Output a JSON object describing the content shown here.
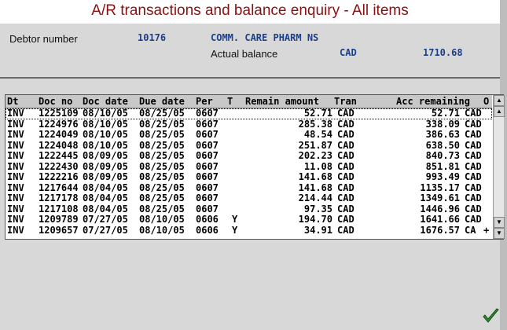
{
  "title": "A/R transactions and balance enquiry - All items",
  "header": {
    "debtor_label": "Debtor number",
    "debtor_number": "10176",
    "debtor_name": "COMM. CARE PHARM NS",
    "balance_label": "Actual balance",
    "balance_currency": "CAD",
    "balance_amount": "1710.68"
  },
  "columns": [
    "Dt",
    "Doc no",
    "Doc date",
    "Due date",
    "Per",
    "T",
    "Remain amount",
    "Tran",
    "Acc remaining",
    "O"
  ],
  "rows": [
    {
      "dt": "INV",
      "doc": "1225109",
      "docdate": "08/10/05",
      "duedate": "08/25/05",
      "per": "0607",
      "t": "",
      "remain": "52.71",
      "tran": "CAD",
      "acc": "52.71",
      "cur": "CAD",
      "o": ""
    },
    {
      "dt": "INV",
      "doc": "1224976",
      "docdate": "08/10/05",
      "duedate": "08/25/05",
      "per": "0607",
      "t": "",
      "remain": "285.38",
      "tran": "CAD",
      "acc": "338.09",
      "cur": "CAD",
      "o": ""
    },
    {
      "dt": "INV",
      "doc": "1224049",
      "docdate": "08/10/05",
      "duedate": "08/25/05",
      "per": "0607",
      "t": "",
      "remain": "48.54",
      "tran": "CAD",
      "acc": "386.63",
      "cur": "CAD",
      "o": ""
    },
    {
      "dt": "INV",
      "doc": "1224048",
      "docdate": "08/10/05",
      "duedate": "08/25/05",
      "per": "0607",
      "t": "",
      "remain": "251.87",
      "tran": "CAD",
      "acc": "638.50",
      "cur": "CAD",
      "o": ""
    },
    {
      "dt": "INV",
      "doc": "1222445",
      "docdate": "08/09/05",
      "duedate": "08/25/05",
      "per": "0607",
      "t": "",
      "remain": "202.23",
      "tran": "CAD",
      "acc": "840.73",
      "cur": "CAD",
      "o": ""
    },
    {
      "dt": "INV",
      "doc": "1222430",
      "docdate": "08/09/05",
      "duedate": "08/25/05",
      "per": "0607",
      "t": "",
      "remain": "11.08",
      "tran": "CAD",
      "acc": "851.81",
      "cur": "CAD",
      "o": ""
    },
    {
      "dt": "INV",
      "doc": "1222216",
      "docdate": "08/09/05",
      "duedate": "08/25/05",
      "per": "0607",
      "t": "",
      "remain": "141.68",
      "tran": "CAD",
      "acc": "993.49",
      "cur": "CAD",
      "o": ""
    },
    {
      "dt": "INV",
      "doc": "1217644",
      "docdate": "08/04/05",
      "duedate": "08/25/05",
      "per": "0607",
      "t": "",
      "remain": "141.68",
      "tran": "CAD",
      "acc": "1135.17",
      "cur": "CAD",
      "o": ""
    },
    {
      "dt": "INV",
      "doc": "1217178",
      "docdate": "08/04/05",
      "duedate": "08/25/05",
      "per": "0607",
      "t": "",
      "remain": "214.44",
      "tran": "CAD",
      "acc": "1349.61",
      "cur": "CAD",
      "o": ""
    },
    {
      "dt": "INV",
      "doc": "1217108",
      "docdate": "08/04/05",
      "duedate": "08/25/05",
      "per": "0607",
      "t": "",
      "remain": "97.35",
      "tran": "CAD",
      "acc": "1446.96",
      "cur": "CAD",
      "o": ""
    },
    {
      "dt": "INV",
      "doc": "1209789",
      "docdate": "07/27/05",
      "duedate": "08/10/05",
      "per": "0606",
      "t": "Y",
      "remain": "194.70",
      "tran": "CAD",
      "acc": "1641.66",
      "cur": "CAD",
      "o": ""
    },
    {
      "dt": "INV",
      "doc": "1209657",
      "docdate": "07/27/05",
      "duedate": "08/10/05",
      "per": "0606",
      "t": "Y",
      "remain": "34.91",
      "tran": "CAD",
      "acc": "1676.57",
      "cur": "CA",
      "o": "+"
    }
  ],
  "scrollbar": {
    "up_icon": "arrow-up-bar-icon",
    "down_icon": "arrow-down-bar-icon"
  },
  "ok_icon": "checkmark-icon",
  "colors": {
    "title": "#8a1010",
    "value": "#1c3f8c",
    "ok": "#2e8b2e"
  }
}
